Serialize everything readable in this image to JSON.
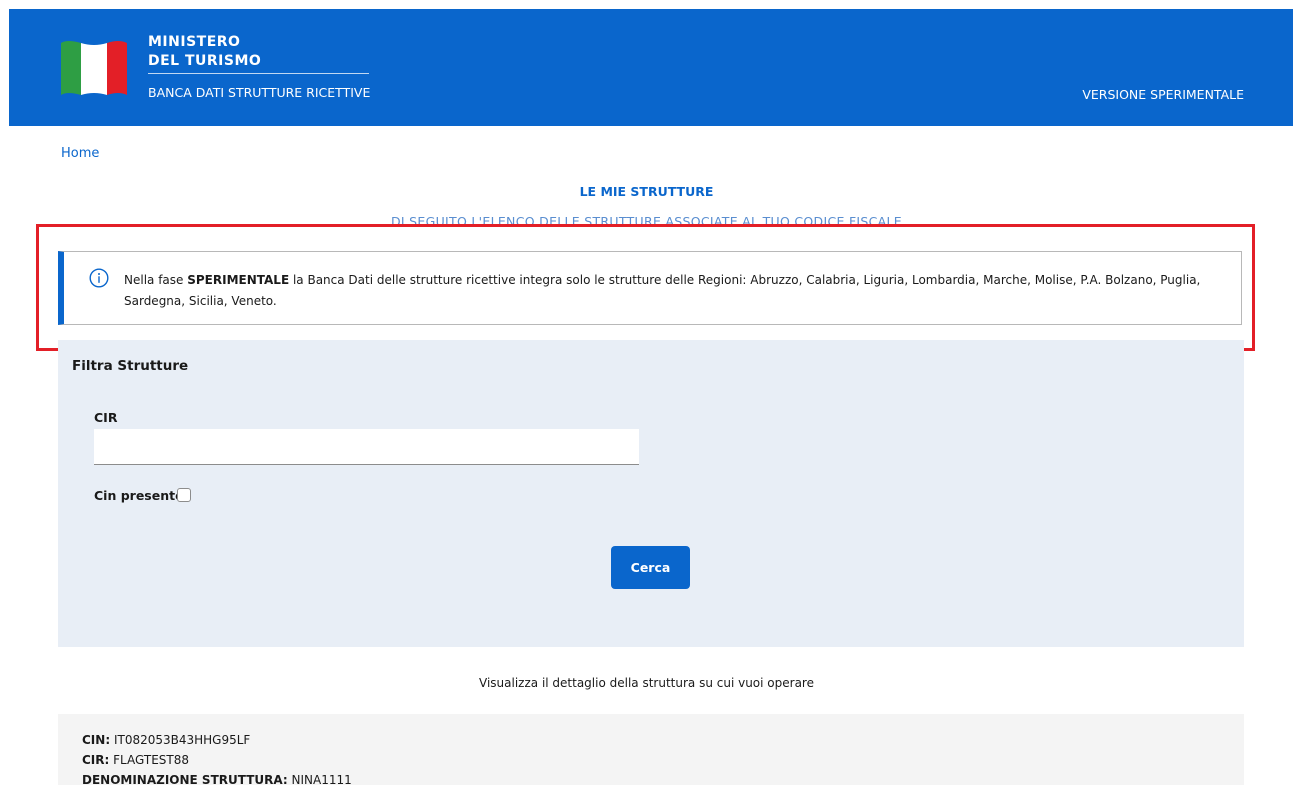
{
  "header": {
    "title_line1": "MINISTERO",
    "title_line2": "DEL TURISMO",
    "subtitle": "BANCA DATI STRUTTURE RICETTIVE",
    "version_label": "VERSIONE SPERIMENTALE",
    "colors": {
      "background": "#0a66cc",
      "flag_green": "#2e9e44",
      "flag_white": "#ffffff",
      "flag_red": "#e31f27"
    }
  },
  "breadcrumb": {
    "home_label": "Home"
  },
  "page": {
    "title": "LE MIE STRUTTURE",
    "subtitle": "DI SEGUITO L'ELENCO DELLE STRUTTURE ASSOCIATE AL TUO CODICE FISCALE"
  },
  "info_box": {
    "icon": "info-circle-icon",
    "text_before": "Nella fase ",
    "text_bold": "SPERIMENTALE",
    "text_after": " la Banca Dati delle strutture ricettive integra solo le strutture delle Regioni: Abruzzo, Calabria, Liguria, Lombardia, Marche, Molise, P.A. Bolzano, Puglia, Sardegna, Sicilia, Veneto.",
    "highlight_color": "#e31f27"
  },
  "filter": {
    "title": "Filtra Strutture",
    "cir_label": "CIR",
    "cir_value": "",
    "cin_label": "Cin presente",
    "cin_checked": false,
    "search_button": "Cerca"
  },
  "detail_caption": "Visualizza il dettaglio della struttura su cui vuoi operare",
  "result": {
    "cin_label": "CIN:",
    "cin_value": "IT082053B43HHG95LF",
    "cir_label": "CIR:",
    "cir_value": "FLAGTEST88",
    "name_label": "DENOMINAZIONE STRUTTURA:",
    "name_value": "NINA1111"
  }
}
